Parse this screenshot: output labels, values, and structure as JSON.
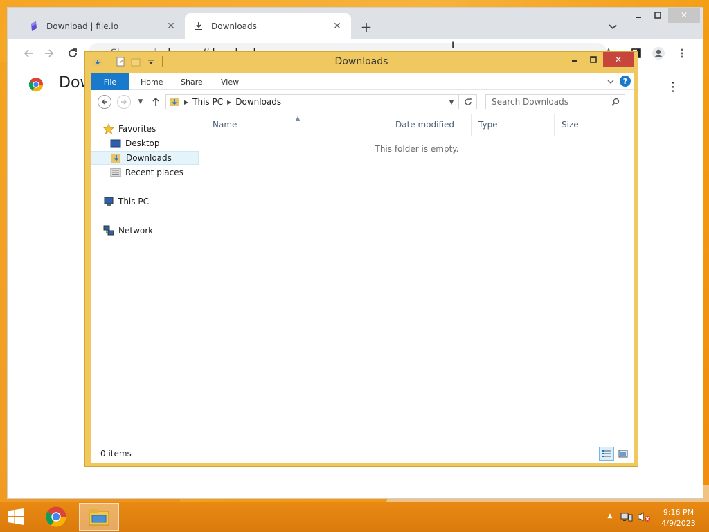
{
  "chrome": {
    "tabs": [
      {
        "title": "Download | file.io",
        "icon": "file-io-logo-icon"
      },
      {
        "title": "Downloads",
        "icon": "download-icon"
      }
    ],
    "omnibox": {
      "site_label": "Chrome",
      "url": "chrome://downloads"
    },
    "page": {
      "heading": "Downloads"
    }
  },
  "explorer": {
    "title": "Downloads",
    "ribbon_tabs": [
      "File",
      "Home",
      "Share",
      "View"
    ],
    "breadcrumb": [
      "This PC",
      "Downloads"
    ],
    "search_placeholder": "Search Downloads",
    "nav": {
      "favorites": "Favorites",
      "desktop": "Desktop",
      "downloads": "Downloads",
      "recent": "Recent places",
      "thispc": "This PC",
      "network": "Network"
    },
    "columns": [
      "Name",
      "Date modified",
      "Type",
      "Size"
    ],
    "empty_message": "This folder is empty.",
    "status": "0 items"
  },
  "taskbar": {
    "time": "9:16 PM",
    "date": "4/9/2023"
  },
  "colors": {
    "explorer_frame": "#f0c860",
    "ribbon_file": "#1979ca",
    "close_red": "#c7453a",
    "taskbar": "#e98a14"
  }
}
